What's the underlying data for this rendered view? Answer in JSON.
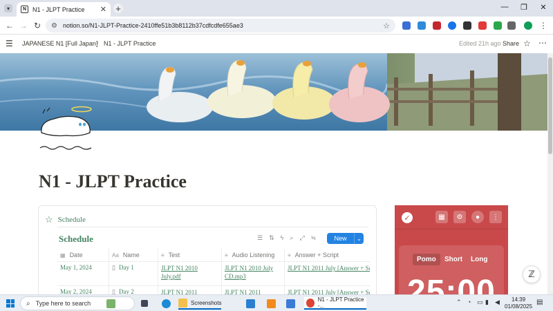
{
  "browser": {
    "tab_title": "N1 - JLPT Practice",
    "tab_favicon": "N",
    "close_glyph": "✕",
    "new_tab_glyph": "+",
    "url": "notion.so/N1-JLPT-Practice-2410ffe51b3b8112b37cdfcdfe655ae3"
  },
  "notion": {
    "breadcrumb_parent": "JAPANESE N1 [Full Japan]",
    "breadcrumb_current": "N1 - JLPT Practice",
    "edited": "Edited 21h ago",
    "share": "Share",
    "page_title": "N1 - JLPT Practice"
  },
  "schedule": {
    "callout_title": "Schedule",
    "db_title": "Schedule",
    "new_label": "New",
    "columns": [
      "Date",
      "Name",
      "Test",
      "Audio Listening",
      "Answer + Script"
    ],
    "rows": [
      {
        "date": "May 1, 2024",
        "name": "Day 1",
        "test": "JLPT N1 2010 July.pdf",
        "audio": "JLPT N1 2010 July CD.mp3",
        "answer": "JLPT N1 2011 July [Answer + Sc"
      },
      {
        "date": "May 2, 2024",
        "name": "Day 2",
        "test": "JLPT N1 2011",
        "audio": "JLPT N1 2011",
        "answer": "JLPT N1 2011 July [Answer + Sc"
      }
    ]
  },
  "pomodoro": {
    "modes": [
      "Pomo",
      "Short",
      "Long"
    ],
    "active_mode": "Pomo",
    "timer": "25:00",
    "colors": {
      "bg": "#c9494a"
    }
  },
  "taskbar": {
    "search_placeholder": "Type here to search",
    "items": [
      {
        "label": "Screenshots"
      },
      {
        "label": "N1 - JLPT Practice -..."
      }
    ],
    "time": "14:39",
    "date": "01/08/2025"
  }
}
